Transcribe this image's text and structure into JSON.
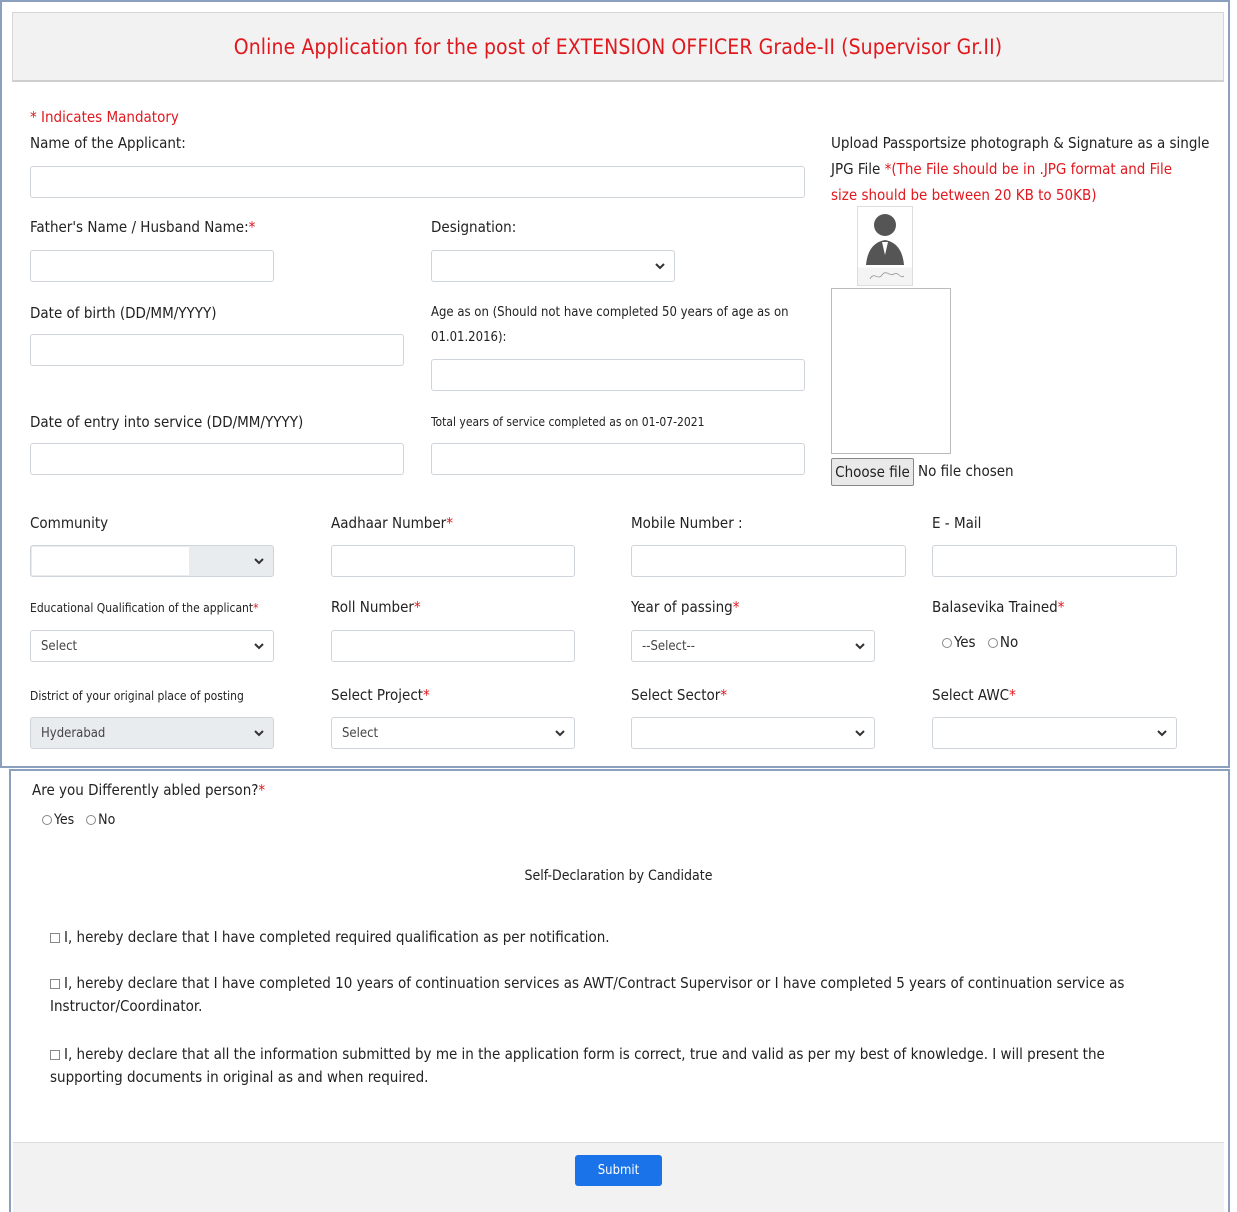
{
  "header": {
    "title": "Online Application for the post of EXTENSION OFFICER Grade-II (Supervisor Gr.II)"
  },
  "form": {
    "mandatory_note": "* Indicates Mandatory",
    "applicant_name_label": "Name of the Applicant:",
    "father_name_label": "Father's Name / Husband Name:",
    "designation_label": "Designation:",
    "dob_label": "Date of birth (DD/MM/YYYY)",
    "age_label_line1": "Age as on (Should not have completed 50 years of age as on",
    "age_label_line2": "01.01.2016):",
    "entry_label": "Date of entry into service (DD/MM/YYYY)",
    "service_years_label": "Total years of service completed as on 01-07-2021",
    "community_label": "Community",
    "aadhaar_label": "Aadhaar Number",
    "mobile_label": "Mobile Number :",
    "email_label": "E - Mail",
    "qualification_label": "Educational Qualification of the applicant",
    "qualification_value": "Select",
    "roll_label": "Roll Number",
    "year_label": "Year of passing",
    "year_value": "--Select--",
    "balasevika_label": "Balasevika Trained",
    "district_label": "District of your original place of posting",
    "district_value": "Hyderabad",
    "project_label": "Select Project",
    "project_value": "Select",
    "sector_label": "Select Sector",
    "awc_label": "Select AWC",
    "yes": "Yes",
    "no": "No",
    "star": "*"
  },
  "upload": {
    "line1": "Upload Passportsize photograph & Signature as a single",
    "line2_prefix": "JPG File ",
    "line2_red": "*(The File should be in .JPG format and File",
    "line3_red": "size should be between 20 KB to 50KB)",
    "choose_file": "Choose file",
    "no_file": "No file chosen"
  },
  "lower": {
    "disabled_question": "Are you Differently abled person?",
    "declaration_title": "Self-Declaration by Candidate",
    "declarations": [
      "I, hereby declare that I have completed required qualification as per notification.",
      "I, hereby declare that I have completed 10 years of continuation services as AWT/Contract Supervisor or I have completed 5 years of continuation service as Instructor/Coordinator.",
      "I, hereby declare that all the information submitted by me in the application form is correct, true and valid as per my best of knowledge. I will present the supporting documents in original as and when required."
    ],
    "submit": "Submit"
  }
}
